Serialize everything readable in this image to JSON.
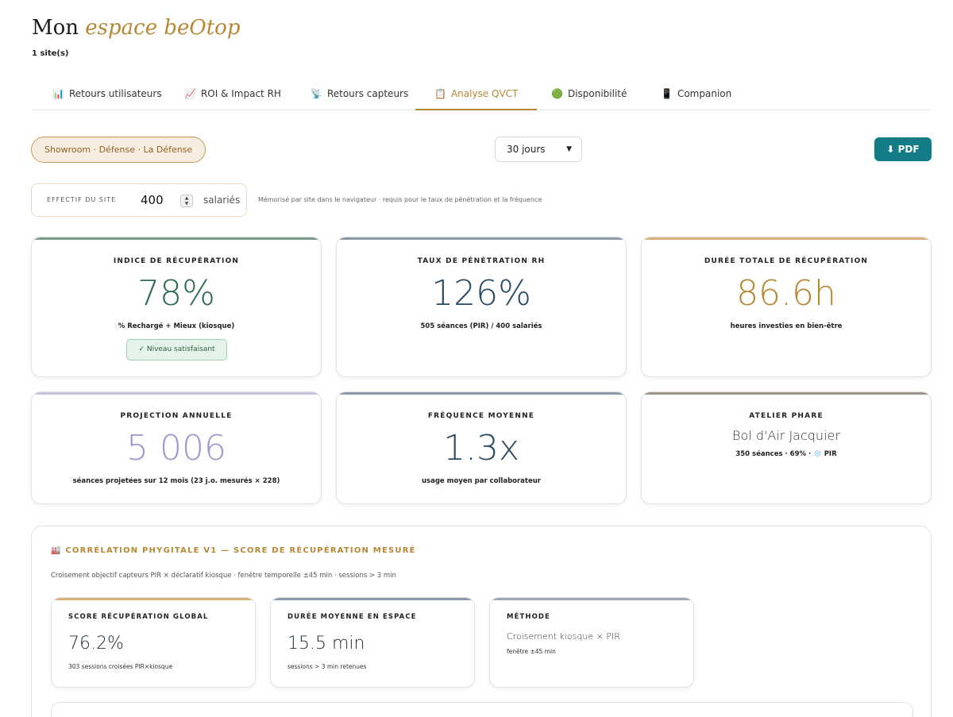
{
  "header": {
    "title_prefix": "Mon",
    "title_accent": "espace beOtop",
    "sites_count": "1 site(s)"
  },
  "tabs": [
    {
      "icon": "📊",
      "label": "Retours utilisateurs"
    },
    {
      "icon": "📈",
      "label": "ROI & Impact RH"
    },
    {
      "icon": "📡",
      "label": "Retours capteurs"
    },
    {
      "icon": "📋",
      "label": "Analyse QVCT",
      "active": true
    },
    {
      "icon": "🟢",
      "label": "Disponibilité"
    },
    {
      "icon": "📱",
      "label": "Companion"
    }
  ],
  "filters": {
    "site": "Showroom · Défense · La Défense",
    "period": "30 jours",
    "pdf_label": "⬇ PDF"
  },
  "effectif": {
    "label": "EFFECTIF DU SITE",
    "value": "400",
    "unit": "salariés",
    "note": "Mémorisé par site dans le navigateur · requis pour le taux de pénétration et la fréquence"
  },
  "kpis": [
    {
      "label": "INDICE DE RÉCUPÉRATION",
      "value": "78%",
      "sub": "% Rechargé + Mieux (kiosque)",
      "badge": "✓ Niveau satisfaisant",
      "color": "#2f6b4f",
      "bar": "#7a9c8a"
    },
    {
      "label": "TAUX DE PÉNÉTRATION RH",
      "value": "126%",
      "sub": "505 séances (PIR) / 400 salariés",
      "color": "#2b4a63",
      "bar": "#8a9aaa"
    },
    {
      "label": "DURÉE TOTALE DE RÉCUPÉRATION",
      "value": "86.6h",
      "sub": "heures investies en bien-être",
      "color": "#b78834",
      "bar": "#d8b27a"
    },
    {
      "label": "PROJECTION ANNUELLE",
      "value": "5 006",
      "sub": "séances projetées sur 12 mois (23 j.o. mesurés × 228)",
      "color": "#9d98cf",
      "bar": "#c5c1e3"
    },
    {
      "label": "FRÉQUENCE MOYENNE",
      "value": "1.3x",
      "sub": "usage moyen par collaborateur",
      "color": "#2b4a63",
      "bar": "#8a9aaa"
    },
    {
      "label": "ATELIER PHARE",
      "name": "Bol d'Air Jacquier",
      "sub": "350 séances · 69% · ❄️ PIR",
      "bar": "#9e948a"
    }
  ],
  "correlation": {
    "title": "🏭 CORRÉLATION PHYGITALE V1 — SCORE DE RÉCUPÉRATION MESURÉ",
    "description": "Croisement objectif capteurs PIR × déclaratif kiosque · fenêtre temporelle ±45 min · sessions > 3 min",
    "cards": [
      {
        "label": "SCORE RÉCUPÉRATION GLOBAL",
        "value": "76.2%",
        "sub": "303 sessions croisées PIR×kiosque",
        "bar": "#d8b27a"
      },
      {
        "label": "DURÉE MOYENNE EN ESPACE",
        "value": "15.5 min",
        "sub": "sessions > 3 min retenues",
        "bar": "#8a9aaa"
      },
      {
        "label": "MÉTHODE",
        "value": "Croisement kiosque × PIR",
        "sub": "fenêtre ±45 min",
        "bar": "#9aa8b6"
      }
    ]
  }
}
